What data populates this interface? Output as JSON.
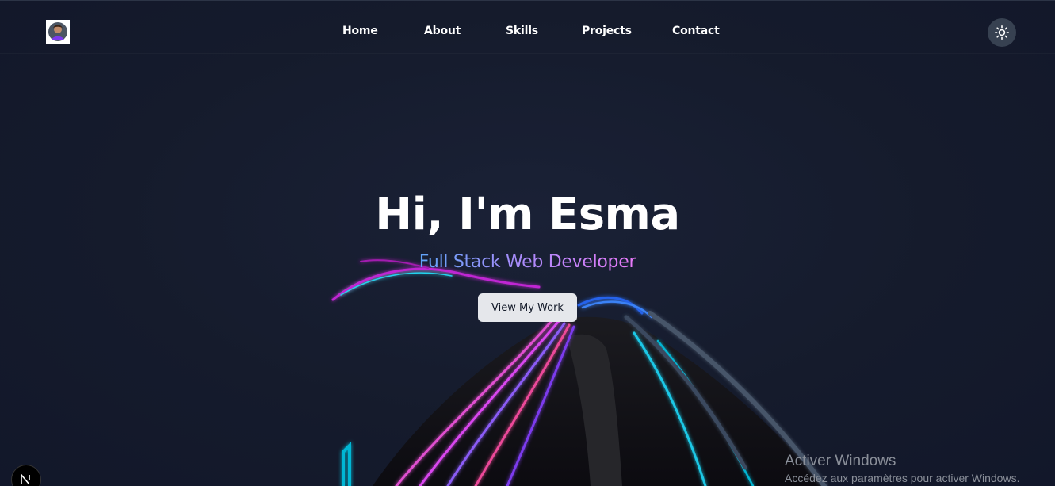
{
  "nav": {
    "logo_icon": "avatar-logo",
    "links": [
      "Home",
      "About",
      "Skills",
      "Projects",
      "Contact"
    ],
    "theme_toggle_icon": "sun-icon"
  },
  "hero": {
    "title": "Hi, I'm Esma",
    "subtitle": "Full Stack Web Developer",
    "cta_label": "View My Work"
  },
  "badge": {
    "label": "N"
  },
  "watermark": {
    "title": "Activer Windows",
    "subtitle": "Accédez aux paramètres pour activer Windows."
  },
  "colors": {
    "background": "#141a2b",
    "text": "#ffffff",
    "toggle_bg": "#374151",
    "cta_bg": "#e5e7eb",
    "gradient_start": "#60a5fa",
    "gradient_mid": "#a78bfa",
    "gradient_end": "#e879f9",
    "neon_pink": "#e04fd0",
    "neon_cyan": "#1ec8e6",
    "neon_blue": "#2563eb"
  }
}
